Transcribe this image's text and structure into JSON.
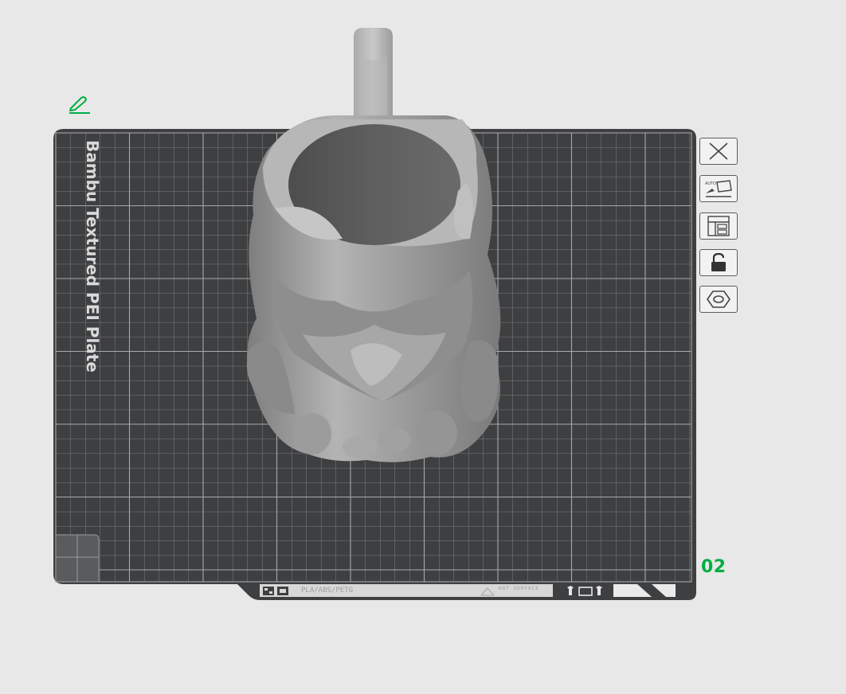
{
  "plate": {
    "label": "Bambu Textured PEI Plate",
    "number": "02",
    "material_tag": "PLA/ABS/PETG",
    "surface_tag": "HOT SURFACE"
  },
  "toolbar": {
    "items": [
      {
        "name": "close-plate-icon"
      },
      {
        "name": "auto-orient-icon"
      },
      {
        "name": "arrange-icon"
      },
      {
        "name": "lock-icon"
      },
      {
        "name": "settings-hex-icon"
      }
    ]
  },
  "colors": {
    "accent": "#00ae42",
    "background": "#e8e8e8",
    "plate": "#3e3f41",
    "grid": "#9a9a9a",
    "model": "#9a9a9a"
  }
}
